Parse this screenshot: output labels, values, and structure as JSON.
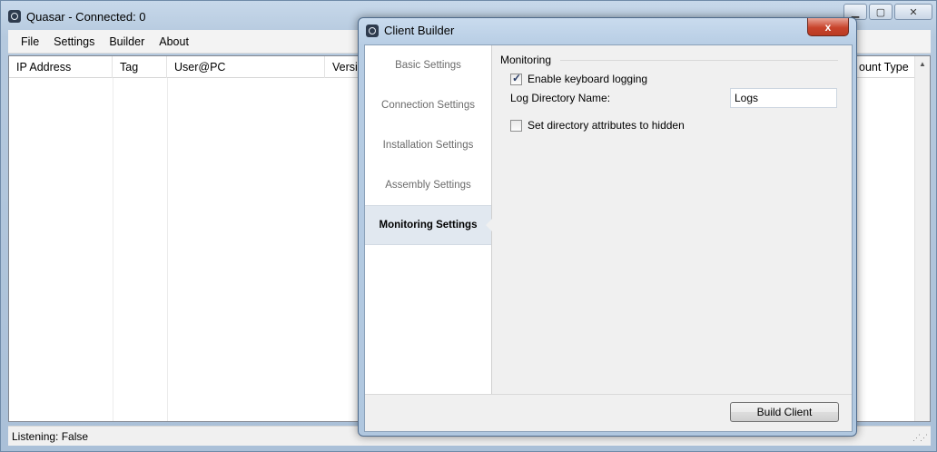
{
  "main": {
    "title": "Quasar - Connected: 0",
    "controls": {
      "minimize": "▁",
      "maximize": "▢",
      "close": "✕"
    },
    "menu": [
      "File",
      "Settings",
      "Builder",
      "About"
    ],
    "columns": [
      "IP Address",
      "Tag",
      "User@PC",
      "Versio",
      "ount Type"
    ],
    "status": "Listening: False"
  },
  "dialog": {
    "title": "Client Builder",
    "close_label": "x",
    "nav": [
      {
        "label": "Basic Settings"
      },
      {
        "label": "Connection Settings"
      },
      {
        "label": "Installation Settings"
      },
      {
        "label": "Assembly Settings"
      },
      {
        "label": "Monitoring Settings"
      }
    ],
    "group_title": "Monitoring",
    "enable_keylog_label": "Enable keyboard logging",
    "enable_keylog_checked": true,
    "log_dir_label": "Log Directory Name:",
    "log_dir_value": "Logs",
    "hidden_attr_label": "Set directory attributes to hidden",
    "hidden_attr_checked": false,
    "build_button": "Build Client"
  }
}
